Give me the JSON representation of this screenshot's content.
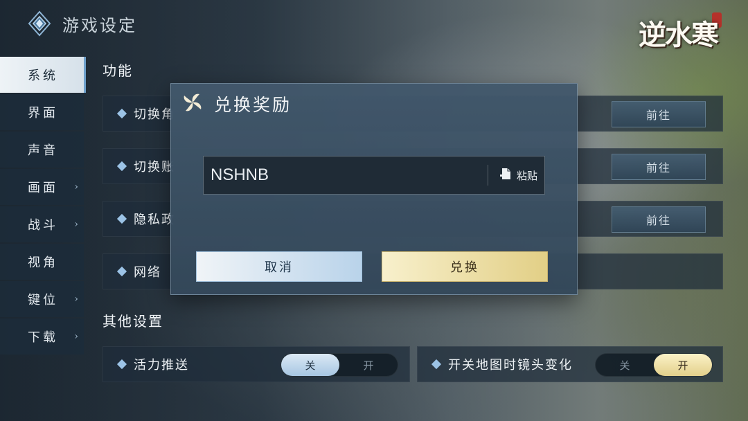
{
  "header": {
    "title": "游戏设定"
  },
  "brand": {
    "logo_text": "逆水寒",
    "logo_icon": "game-logo"
  },
  "sidebar": {
    "items": [
      {
        "label": "系统",
        "chevron": ""
      },
      {
        "label": "界面",
        "chevron": ""
      },
      {
        "label": "声音",
        "chevron": ""
      },
      {
        "label": "画面",
        "chevron": "›"
      },
      {
        "label": "战斗",
        "chevron": "›"
      },
      {
        "label": "视角",
        "chevron": ""
      },
      {
        "label": "键位",
        "chevron": "›"
      },
      {
        "label": "下载",
        "chevron": "›"
      }
    ],
    "active_index": 0
  },
  "functions": {
    "title": "功能",
    "rows": [
      {
        "label": "切换角",
        "button": "前往"
      },
      {
        "label": "切换账",
        "button": "前往"
      },
      {
        "label": "隐私政",
        "button": "前往"
      },
      {
        "label": "网络",
        "button": ""
      }
    ]
  },
  "other": {
    "title": "其他设置",
    "rows": [
      {
        "label": "活力推送",
        "off": "关",
        "on": "开",
        "state": "off"
      },
      {
        "label": "开关地图时镜头变化",
        "off": "关",
        "on": "开",
        "state": "on"
      }
    ]
  },
  "modal": {
    "title": "兑换奖励",
    "code_value": "NSHNB",
    "paste_label": "粘贴",
    "cancel_label": "取消",
    "redeem_label": "兑换"
  },
  "colors": {
    "accent_blue": "#9cc3e6",
    "accent_gold": "#e2cf86",
    "panel": "#1e2d3a"
  }
}
